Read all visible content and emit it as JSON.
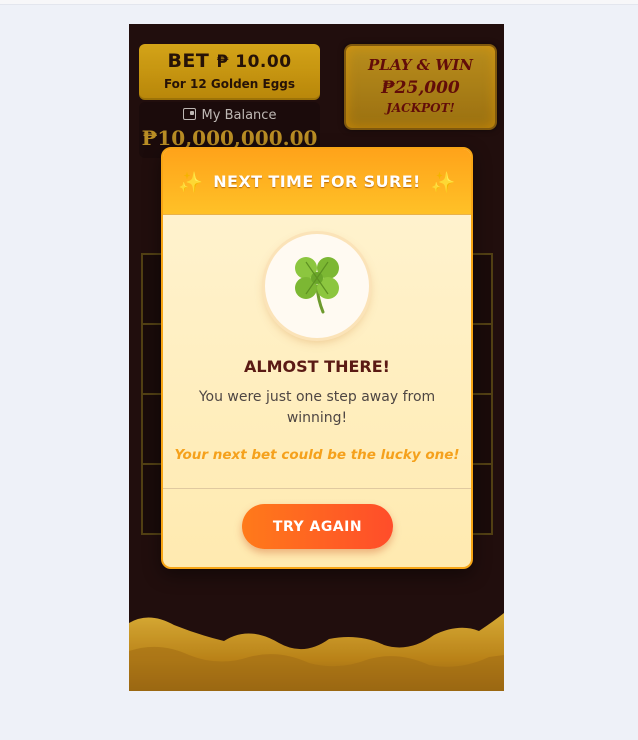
{
  "bet": {
    "label": "BET",
    "amount": "₱ 10.00",
    "subtitle": "For 12 Golden Eggs"
  },
  "balance": {
    "label": "My Balance",
    "value": "₱10,000,000.00",
    "icon": "wallet-icon"
  },
  "jackpot": {
    "line1": "PLAY & WIN",
    "line2": "₱25,000",
    "line3": "JACKPOT!"
  },
  "modal": {
    "title": "NEXT TIME FOR SURE!",
    "sparkle": "✨",
    "heading": "ALMOST THERE!",
    "message": "You were just one step away from winning!",
    "tagline": "Your next bet could be the lucky one!",
    "button_label": "TRY AGAIN",
    "icon": "clover-icon"
  },
  "colors": {
    "background": "#eef1f8",
    "game_bg": "#24100f",
    "gold": "#e6b21a",
    "modal_header": "#ffa31a",
    "button_start": "#ff7a1a",
    "button_end": "#ff4d2a",
    "accent_text": "#f5a11c"
  }
}
